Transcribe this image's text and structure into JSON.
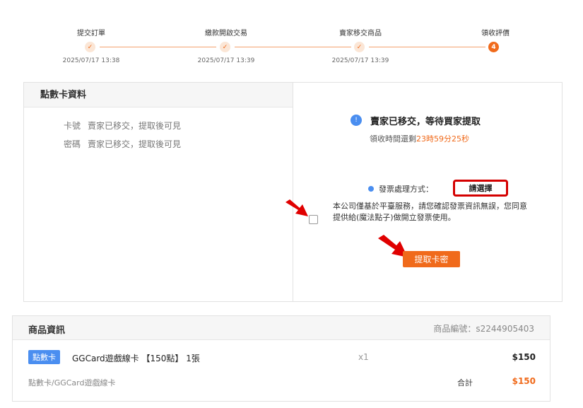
{
  "stepper": {
    "steps": [
      {
        "label": "提交訂單",
        "date": "2025/07/17 13:38",
        "marker": "✓"
      },
      {
        "label": "繳款開啟交易",
        "date": "2025/07/17 13:39",
        "marker": "✓"
      },
      {
        "label": "賣家移交商品",
        "date": "2025/07/17 13:39",
        "marker": "✓"
      },
      {
        "label": "領收評價",
        "date": "",
        "marker": "4"
      }
    ]
  },
  "card_info": {
    "title": "點數卡資料",
    "rows": [
      {
        "key": "卡號",
        "value": "賣家已移交，提取後可見"
      },
      {
        "key": "密碼",
        "value": "賣家已移交，提取後可見"
      }
    ]
  },
  "status": {
    "icon": "!",
    "title": "賣家已移交，等待買家提取",
    "countdown_prefix": "領收時間還剩",
    "countdown_value": "23時59分25秒"
  },
  "invoice": {
    "label": "發票處理方式：",
    "selected": "請選擇"
  },
  "agreement": {
    "text": "本公司僅基於平臺服務，請您確認發票資訊無誤，您同意提供給(魔法點子)做開立發票使用。"
  },
  "redeem_button": "提取卡密",
  "product": {
    "title": "商品資訊",
    "product_id": "商品編號：s2244905403",
    "badge": "點數卡",
    "name": "GGCard遊戲線卡 【150點】 1張",
    "qty": "x1",
    "price": "$150",
    "category": "點數卡/GGCard遊戲線卡",
    "total_label": "合計",
    "total_value": "$150"
  },
  "colors": {
    "accent": "#f06a1b",
    "info_blue": "#4a8ef0",
    "highlight_red": "#d40000"
  }
}
